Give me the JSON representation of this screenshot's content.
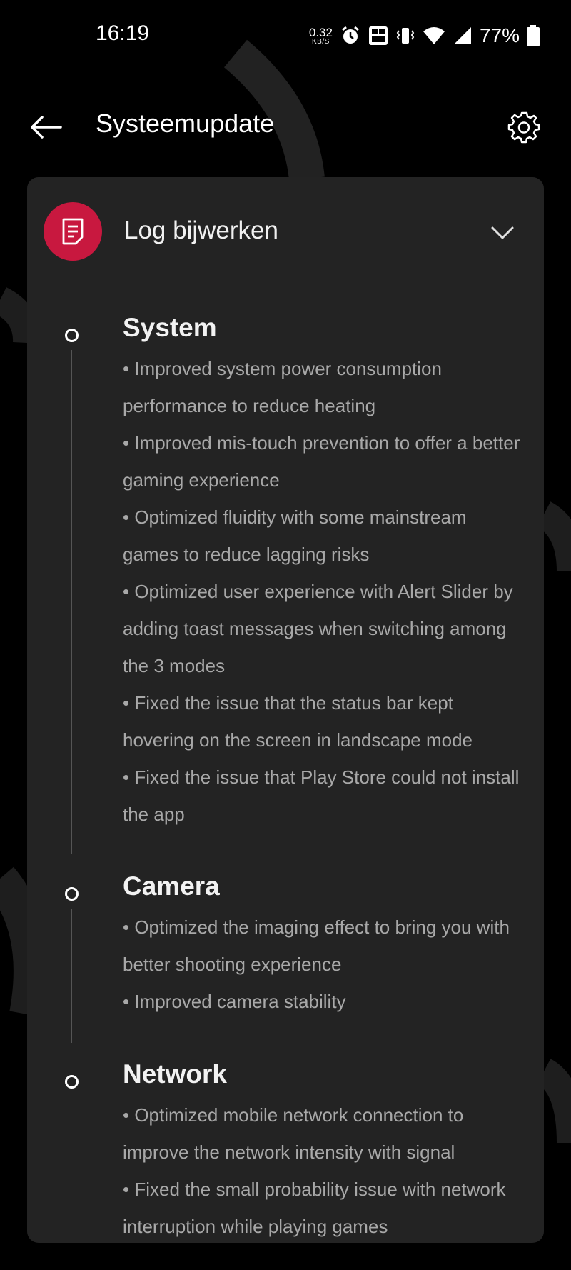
{
  "status_bar": {
    "time": "16:19",
    "net_speed_value": "0.32",
    "net_speed_unit": "KB/S",
    "battery": "77%",
    "icons": [
      "alarm-icon",
      "volte-icon",
      "vibrate-icon",
      "wifi-icon",
      "signal-icon",
      "battery-icon"
    ]
  },
  "header": {
    "back_icon": "arrow-left-icon",
    "title": "Systeemupdate",
    "settings_icon": "gear-icon"
  },
  "card": {
    "icon": "document-icon",
    "icon_color": "#c8183f",
    "title": "Log bijwerken",
    "toggle_icon": "chevron-down-icon",
    "sections": [
      {
        "title": "System",
        "items": [
          "• Improved system power consumption performance to reduce heating",
          "• Improved mis-touch prevention to offer a better gaming experience",
          "• Optimized fluidity with some mainstream games to reduce lagging risks",
          "• Optimized user experience with Alert Slider by adding toast messages when switching among the 3 modes",
          "• Fixed the issue that the status bar kept hovering on the screen in landscape mode",
          "• Fixed the issue that Play Store could not install the app"
        ]
      },
      {
        "title": "Camera",
        "items": [
          "• Optimized the imaging effect to bring you with better shooting experience",
          "• Improved camera stability"
        ]
      },
      {
        "title": "Network",
        "items": [
          "• Optimized mobile network connection to improve the network intensity with signal",
          "• Fixed the small probability issue with network interruption while playing games"
        ]
      }
    ]
  },
  "colors": {
    "background": "#000000",
    "card": "#232323",
    "accent": "#c8183f",
    "body_text": "#a8a8a8"
  }
}
